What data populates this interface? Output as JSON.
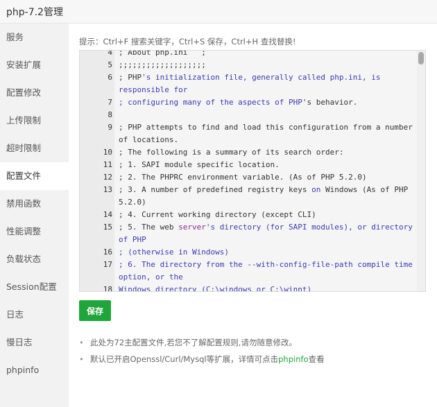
{
  "window": {
    "title": "php-7.2管理"
  },
  "sidebar": {
    "items": [
      {
        "label": "服务"
      },
      {
        "label": "安装扩展"
      },
      {
        "label": "配置修改"
      },
      {
        "label": "上传限制"
      },
      {
        "label": "超时限制"
      },
      {
        "label": "配置文件",
        "active": true
      },
      {
        "label": "禁用函数"
      },
      {
        "label": "性能调整"
      },
      {
        "label": "负载状态"
      },
      {
        "label": "Session配置"
      },
      {
        "label": "日志"
      },
      {
        "label": "慢日志"
      },
      {
        "label": "phpinfo"
      }
    ]
  },
  "main": {
    "hint": "提示：Ctrl+F 搜索关键字，Ctrl+S 保存，Ctrl+H 查找替换!",
    "editor": {
      "lines": [
        {
          "num": "4",
          "segments": [
            {
              "t": "; About php.ini   ;",
              "c": ""
            }
          ]
        },
        {
          "num": "5",
          "segments": [
            {
              "t": ";;;;;;;;;;;;;;;;;;;",
              "c": ""
            }
          ]
        },
        {
          "num": "6",
          "segments": [
            {
              "t": "; PHP",
              "c": ""
            },
            {
              "t": "'s initialization file, generally called php.ini, is responsible for",
              "c": "blue"
            }
          ]
        },
        {
          "num": "7",
          "segments": [
            {
              "t": "; configuring many of the aspects of PHP",
              "c": "blue"
            },
            {
              "t": "'s behavior.",
              "c": ""
            }
          ]
        },
        {
          "num": "8",
          "segments": [
            {
              "t": "",
              "c": ""
            }
          ]
        },
        {
          "num": "9",
          "segments": [
            {
              "t": "; PHP attempts to find and load this configuration from a number of locations.",
              "c": ""
            }
          ]
        },
        {
          "num": "10",
          "segments": [
            {
              "t": "; The following is a summary of its search order:",
              "c": ""
            }
          ]
        },
        {
          "num": "11",
          "segments": [
            {
              "t": "; 1. SAPI module specific location.",
              "c": ""
            }
          ]
        },
        {
          "num": "12",
          "segments": [
            {
              "t": "; 2. The PHPRC environment variable. (As of PHP 5.2.0)",
              "c": ""
            }
          ]
        },
        {
          "num": "13",
          "segments": [
            {
              "t": "; 3. A number of predefined registry keys ",
              "c": ""
            },
            {
              "t": "on",
              "c": "blue"
            },
            {
              "t": " Windows (As of PHP 5.2.0)",
              "c": ""
            }
          ]
        },
        {
          "num": "14",
          "segments": [
            {
              "t": "; 4. Current working directory (except CLI)",
              "c": ""
            }
          ]
        },
        {
          "num": "15",
          "segments": [
            {
              "t": "; 5. The web ",
              "c": ""
            },
            {
              "t": "server",
              "c": "purple"
            },
            {
              "t": "'s directory (for SAPI modules), or directory of PHP",
              "c": "blue"
            }
          ]
        },
        {
          "num": "16",
          "segments": [
            {
              "t": "; (otherwise in Windows)",
              "c": "blue"
            }
          ]
        },
        {
          "num": "17",
          "segments": [
            {
              "t": "; 6. The directory from the --with-config-file-path compile time option, or the",
              "c": "blue"
            }
          ]
        },
        {
          "num": "18",
          "segments": [
            {
              "t": "Windows directory (C:\\windows or C:\\winnt)",
              "c": "blue"
            }
          ]
        }
      ]
    },
    "save_label": "保存",
    "notes": {
      "note1": "此处为72主配置文件,若您不了解配置规则,请勿随意修改。",
      "note2_prefix": "默认已开启Openssl/Curl/Mysql等扩展，详情可点击",
      "note2_link": "phpinfo",
      "note2_suffix": "查看",
      "bullet": "•"
    }
  },
  "colors": {
    "accent": "#20a53a",
    "code_blue": "#3b3bb3",
    "code_purple": "#8a2e8a"
  }
}
